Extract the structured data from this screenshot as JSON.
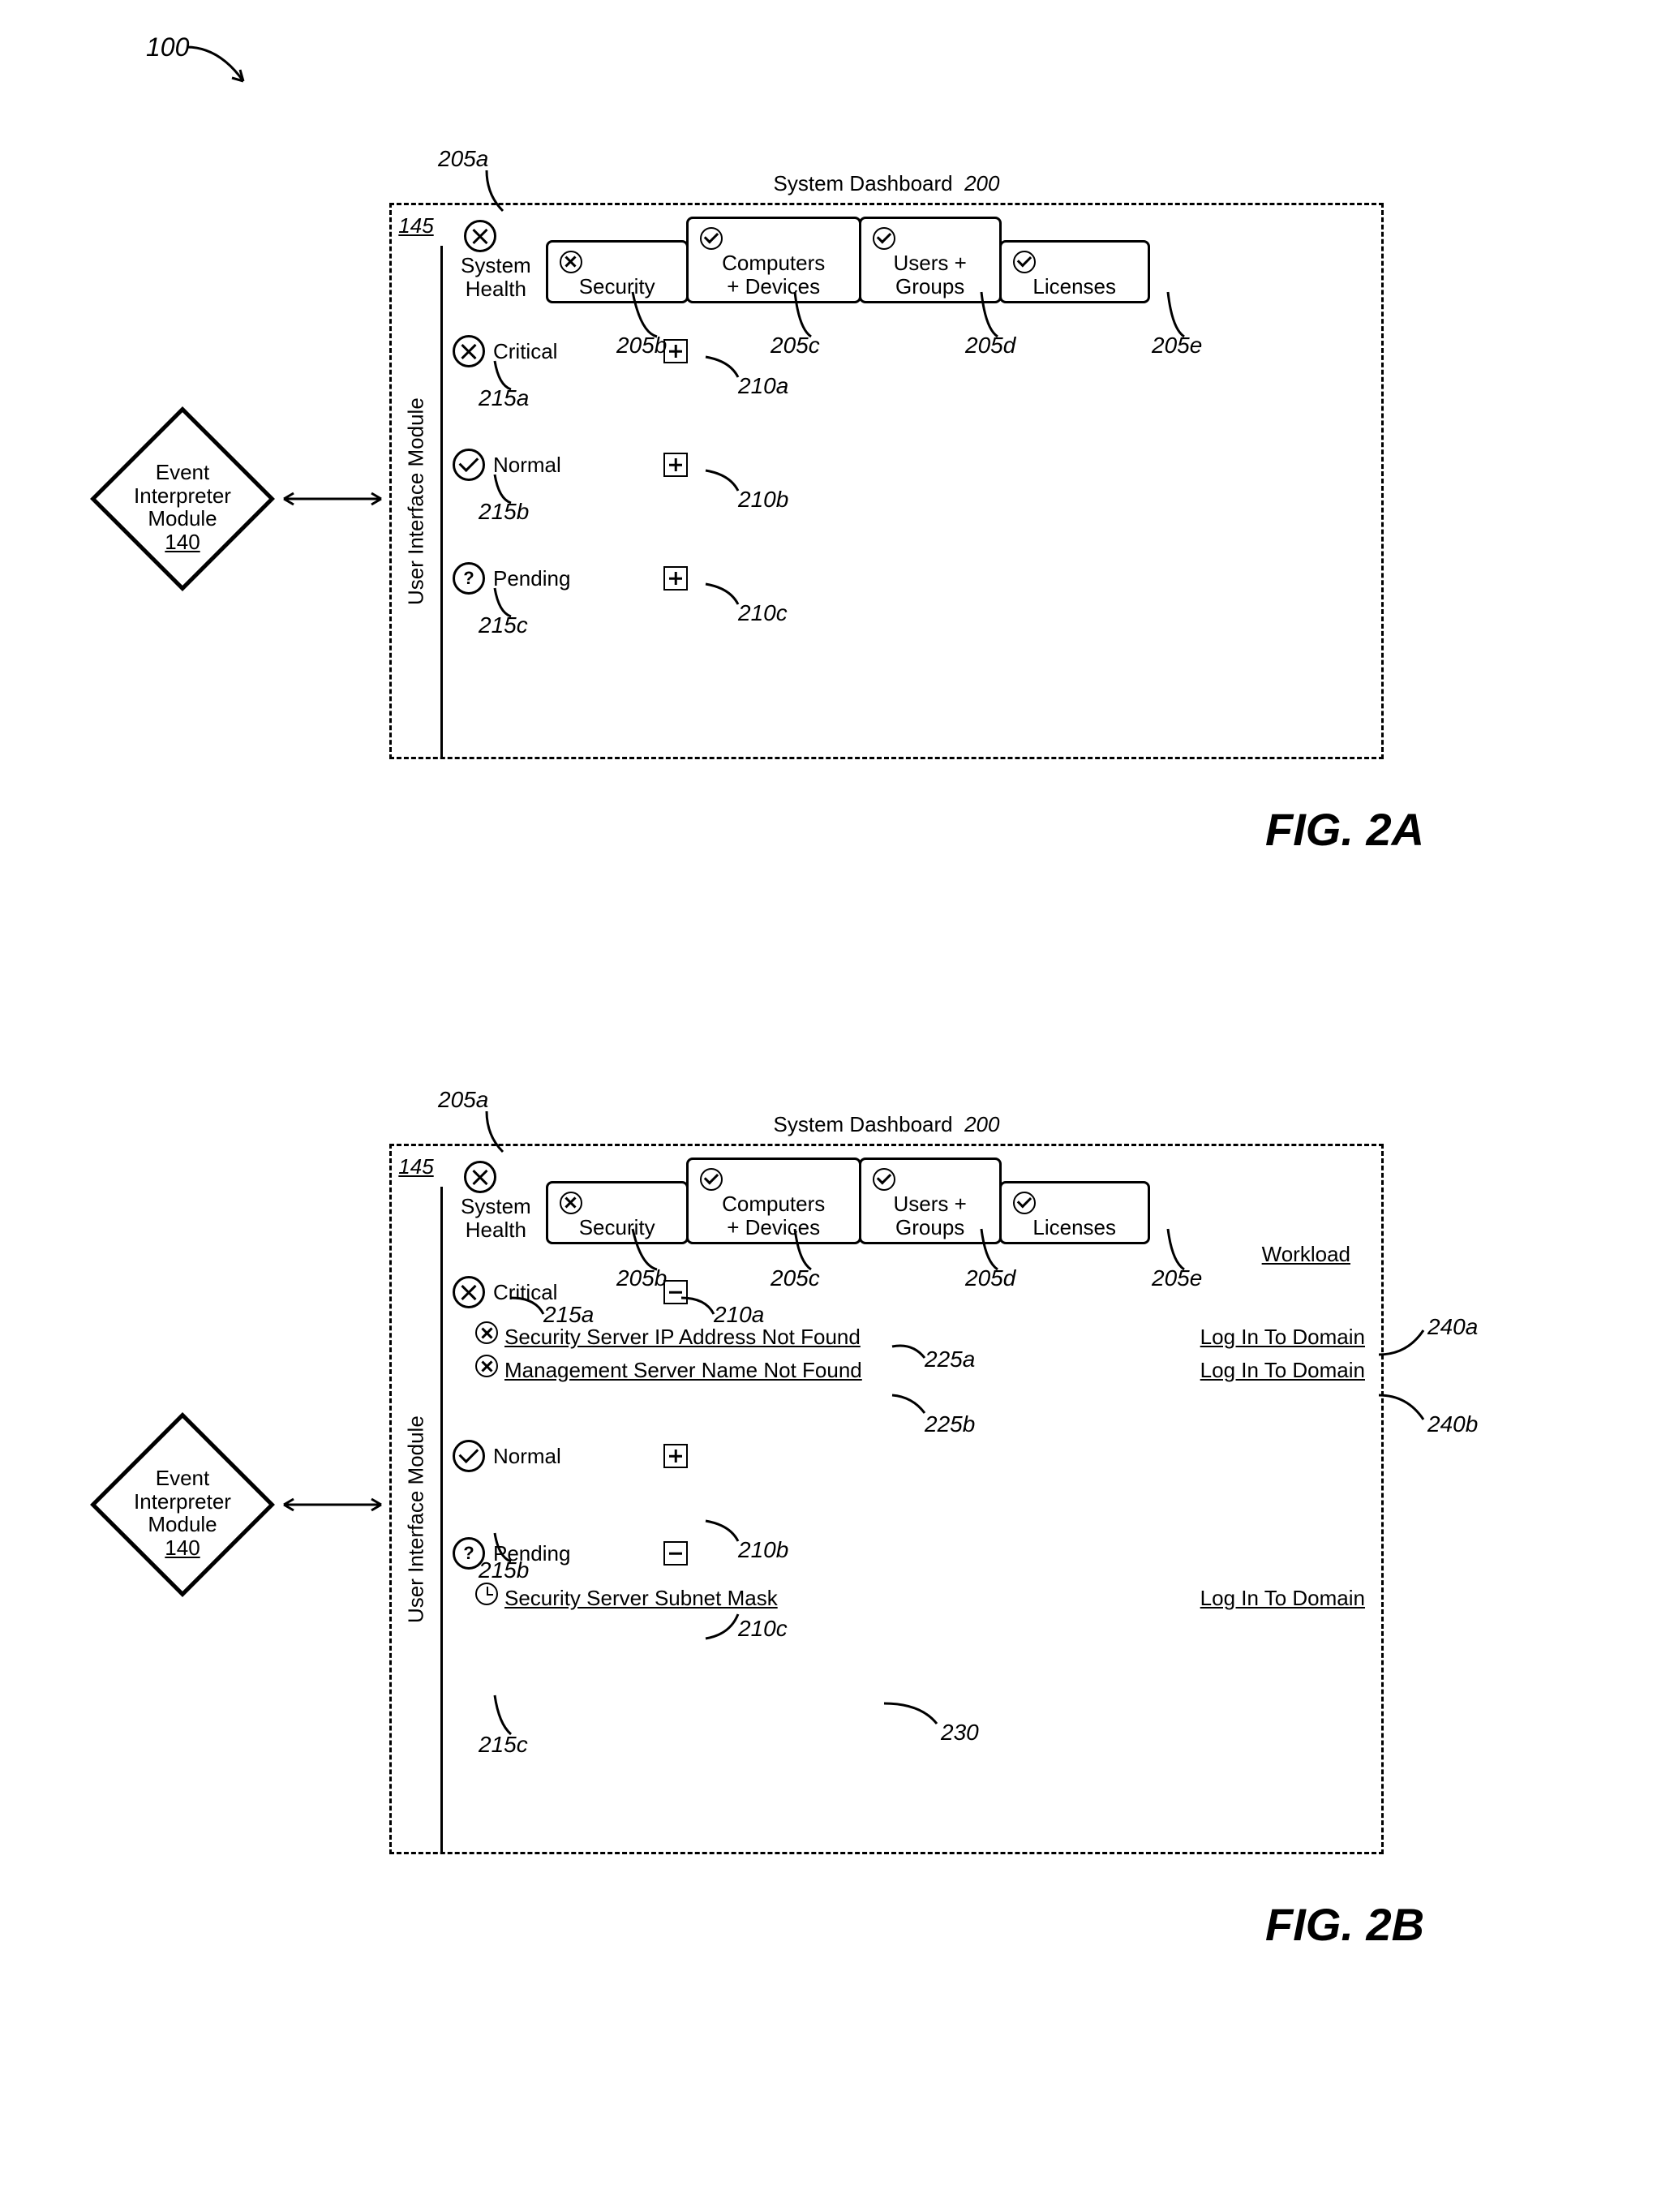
{
  "page_ref": "100",
  "fig_a_label": "FIG. 2A",
  "fig_b_label": "FIG. 2B",
  "event_interpreter": {
    "line1": "Event",
    "line2": "Interpreter",
    "line3": "Module",
    "num": "140"
  },
  "uim": {
    "label_num": "145",
    "text": "User Interface Module"
  },
  "dashboard_title": "System Dashboard",
  "dashboard_title_num": "200",
  "tabs": {
    "a": "System\nHealth",
    "b": "Security",
    "c": "Computers\n+ Devices",
    "d": "Users +\nGroups",
    "e": "Licenses"
  },
  "figA": {
    "rows": {
      "critical": "Critical",
      "normal": "Normal",
      "pending": "Pending"
    }
  },
  "figB": {
    "workload_header": "Workload",
    "rows": {
      "critical": "Critical",
      "critical_children": [
        {
          "text": "Security Server IP Address Not Found",
          "workload": "Log In To Domain"
        },
        {
          "text": "Management Server Name Not Found",
          "workload": "Log In To Domain"
        }
      ],
      "normal": "Normal",
      "pending": "Pending",
      "pending_children": [
        {
          "text": "Security Server Subnet Mask",
          "workload": "Log In To Domain"
        }
      ]
    }
  },
  "callouts": {
    "t205a": "205a",
    "t205b": "205b",
    "t205c": "205c",
    "t205d": "205d",
    "t205e": "205e",
    "t210a": "210a",
    "t210b": "210b",
    "t210c": "210c",
    "t215a": "215a",
    "t215b": "215b",
    "t215c": "215c",
    "t225a": "225a",
    "t225b": "225b",
    "t230": "230",
    "t240a": "240a",
    "t240b": "240b"
  }
}
